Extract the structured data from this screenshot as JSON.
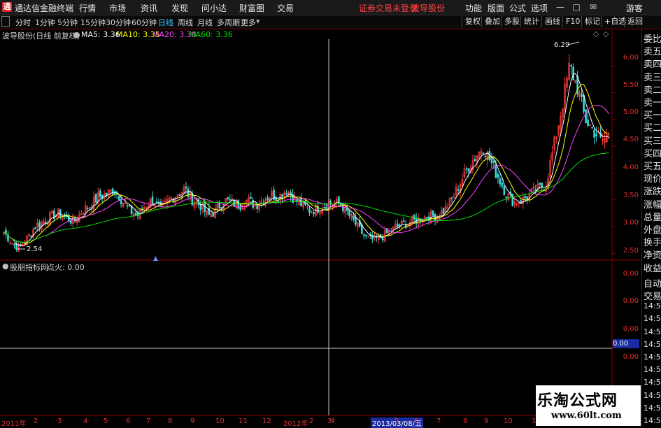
{
  "app": {
    "name": "通达信金融终端",
    "logo": "通"
  },
  "menu": [
    "行情",
    "市场",
    "资讯",
    "发现",
    "问小达",
    "财富圈",
    "交易"
  ],
  "notice": {
    "login": "证券交易未登录",
    "stock": "波导股份"
  },
  "window_menu": [
    "功能",
    "版面",
    "公式",
    "选项"
  ],
  "guest": "游客",
  "periods": [
    "分时",
    "1分钟",
    "5分钟",
    "15分钟",
    "30分钟",
    "60分钟",
    "日线",
    "周线",
    "月线",
    "多周期",
    "更多"
  ],
  "selected_period": "日线",
  "right_toolbar": [
    "复权",
    "叠加",
    "多股",
    "统计",
    "画线",
    "F10",
    "标记",
    "+自选",
    "返回"
  ],
  "main_panel": {
    "title": "波导股份(日线 前复权)",
    "ma": [
      {
        "label": "MA5: 3.36",
        "color": "#ffffff"
      },
      {
        "label": "MA10: 3.35",
        "color": "#ffff00"
      },
      {
        "label": "MA20: 3.38",
        "color": "#ff40ff"
      },
      {
        "label": "MA60: 3.36",
        "color": "#00e000"
      }
    ],
    "y_ticks": [
      "6.00",
      "5.50",
      "5.00",
      "4.50",
      "4.00",
      "3.50",
      "3.00",
      "2.50"
    ],
    "high_label": "6.29",
    "low_label": "2.54",
    "diamond_icons": [
      "◇",
      "◇"
    ]
  },
  "indicator_panel": {
    "title": "股朋指标网",
    "value_label": "点火: 0.00",
    "y_ticks": [
      "0.00",
      "0.00",
      "0.00",
      "0.00"
    ],
    "crosshair_value": "0.00"
  },
  "date_axis": {
    "labels": [
      "2011年",
      "2",
      "3",
      "4",
      "5",
      "6",
      "7",
      "8",
      "9",
      "10",
      "11",
      "12",
      "2012年",
      "2",
      "3",
      "4",
      "2013/03/08/五",
      "5",
      "6",
      "7",
      "8",
      "9",
      "10",
      "11",
      "12"
    ],
    "cursor_date": "2013/03/08/五"
  },
  "side_panel": [
    "委比",
    "卖五",
    "卖四",
    "卖三",
    "卖二",
    "卖一",
    "买一",
    "买二",
    "买三",
    "买四",
    "买五",
    "现价",
    "涨跌",
    "涨幅",
    "总量",
    "外盘",
    "换手",
    "净资",
    "收益",
    "自动",
    "交易",
    "14:56",
    "14:56",
    "14:56",
    "14:56",
    "14:56",
    "14:56",
    "14:56",
    "14:56",
    "14:56",
    "14:56"
  ],
  "watermark": {
    "title": "乐淘公式网",
    "url": "www.60lt.com"
  },
  "chart_data": {
    "type": "candlestick",
    "ylim": [
      2.4,
      6.5
    ],
    "approx_close_path": [
      2.9,
      2.7,
      2.6,
      2.8,
      3.0,
      3.1,
      3.2,
      3.25,
      3.15,
      3.1,
      3.3,
      3.4,
      3.55,
      3.6,
      3.7,
      3.5,
      3.3,
      3.2,
      3.4,
      3.5,
      3.3,
      3.5,
      3.6,
      3.7,
      3.5,
      3.4,
      3.2,
      3.3,
      3.5,
      3.45,
      3.4,
      3.5,
      3.4,
      3.5,
      3.6,
      3.55,
      3.7,
      3.5,
      3.4,
      3.3,
      3.35,
      3.4,
      3.45,
      3.4,
      3.2,
      3.0,
      2.8,
      2.75,
      2.8,
      2.9,
      3.0,
      3.05,
      3.1,
      3.15,
      3.2,
      3.2,
      3.3,
      3.5,
      3.8,
      4.1,
      4.3,
      4.5,
      4.2,
      3.9,
      3.6,
      3.45,
      3.5,
      3.6,
      3.7,
      3.8,
      4.5,
      5.2,
      6.0,
      5.6,
      5.0,
      4.8,
      4.6,
      4.7
    ]
  }
}
